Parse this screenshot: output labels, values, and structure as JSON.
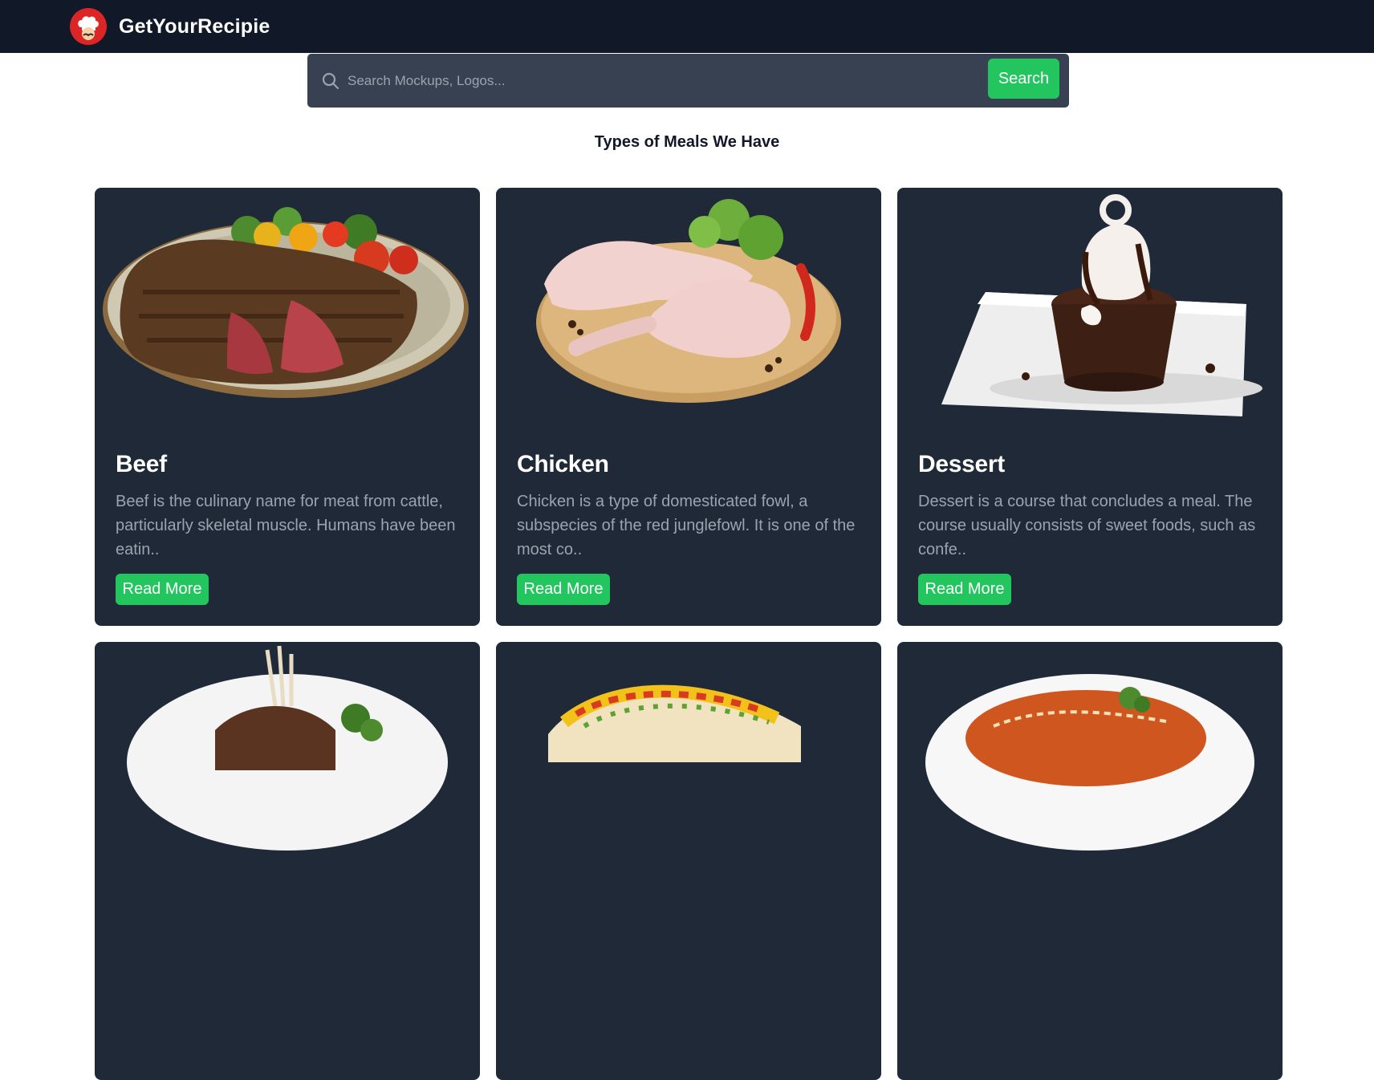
{
  "header": {
    "brand": "GetYourRecipie"
  },
  "search": {
    "placeholder": "Search Mockups, Logos...",
    "value": "",
    "button_label": "Search"
  },
  "section": {
    "title": "Types of Meals We Have"
  },
  "cards": [
    {
      "title": "Beef",
      "description": "Beef is the culinary name for meat from cattle, particularly skeletal muscle. Humans have been eatin..",
      "button_label": "Read More",
      "image": "steak-plate-image"
    },
    {
      "title": "Chicken",
      "description": "Chicken is a type of domesticated fowl, a subspecies of the red junglefowl. It is one of the most co..",
      "button_label": "Read More",
      "image": "raw-chicken-plate-image"
    },
    {
      "title": "Dessert",
      "description": "Dessert is a course that concludes a meal. The course usually consists of sweet foods, such as confe..",
      "button_label": "Read More",
      "image": "chocolate-cake-image"
    },
    {
      "title": "",
      "description": "",
      "button_label": "",
      "image": "lamb-chops-image"
    },
    {
      "title": "",
      "description": "",
      "button_label": "",
      "image": "tacos-image"
    },
    {
      "title": "",
      "description": "",
      "button_label": "",
      "image": "pasta-image"
    }
  ],
  "colors": {
    "navbar": "#111827",
    "card": "#1f2937",
    "accent": "#22c55e",
    "search_bg": "#374151",
    "logo": "#dc2626"
  }
}
